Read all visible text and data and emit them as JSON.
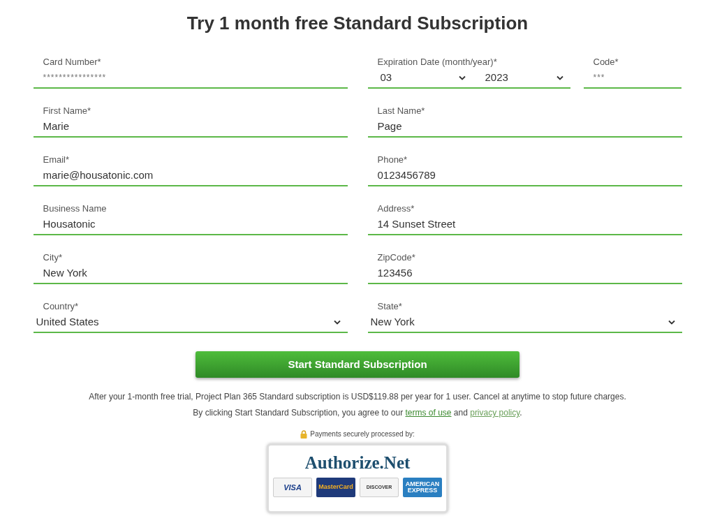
{
  "title": "Try 1 month free Standard Subscription",
  "rows": [
    [
      {
        "kind": "text",
        "label": "Card Number*",
        "placeholder": "****************"
      },
      {
        "kind": "date",
        "label": "Expiration Date (month/year)*",
        "month": "03",
        "year": "2023"
      },
      {
        "kind": "text",
        "label": "Code*",
        "placeholder": "***"
      }
    ],
    [
      {
        "kind": "text",
        "label": "First Name*",
        "value": "Marie"
      },
      {
        "kind": "text",
        "label": "Last Name*",
        "value": "Page"
      }
    ],
    [
      {
        "kind": "text",
        "label": "Email*",
        "value": "marie@housatonic.com"
      },
      {
        "kind": "text",
        "label": "Phone*",
        "value": "0123456789"
      }
    ],
    [
      {
        "kind": "text",
        "label": "Business Name",
        "value": "Housatonic"
      },
      {
        "kind": "text",
        "label": "Address*",
        "value": "14 Sunset Street"
      }
    ],
    [
      {
        "kind": "text",
        "label": "City*",
        "value": "New York"
      },
      {
        "kind": "text",
        "label": "ZipCode*",
        "value": "123456"
      }
    ],
    [
      {
        "kind": "select",
        "label": "Country*",
        "value": "United States"
      },
      {
        "kind": "select",
        "label": "State*",
        "value": "New York"
      }
    ]
  ],
  "submit": "Start Standard Subscription",
  "notice": "After your 1-month free trial, Project Plan 365 Standard subscription is USD$119.88 per year for 1 user. Cancel at anytime to stop future charges.",
  "consent": {
    "before": "By clicking Start Standard Subscription, you agree to our",
    "terms": "terms of use",
    "middle": "and",
    "privacy": "privacy policy",
    "after": "."
  },
  "secure": "Payments securely processed by:",
  "badge": {
    "brand": "Authorize.Net",
    "cards": [
      "VISA",
      "MasterCard",
      "DISCOVER",
      "AMERICAN EXPRESS"
    ]
  }
}
